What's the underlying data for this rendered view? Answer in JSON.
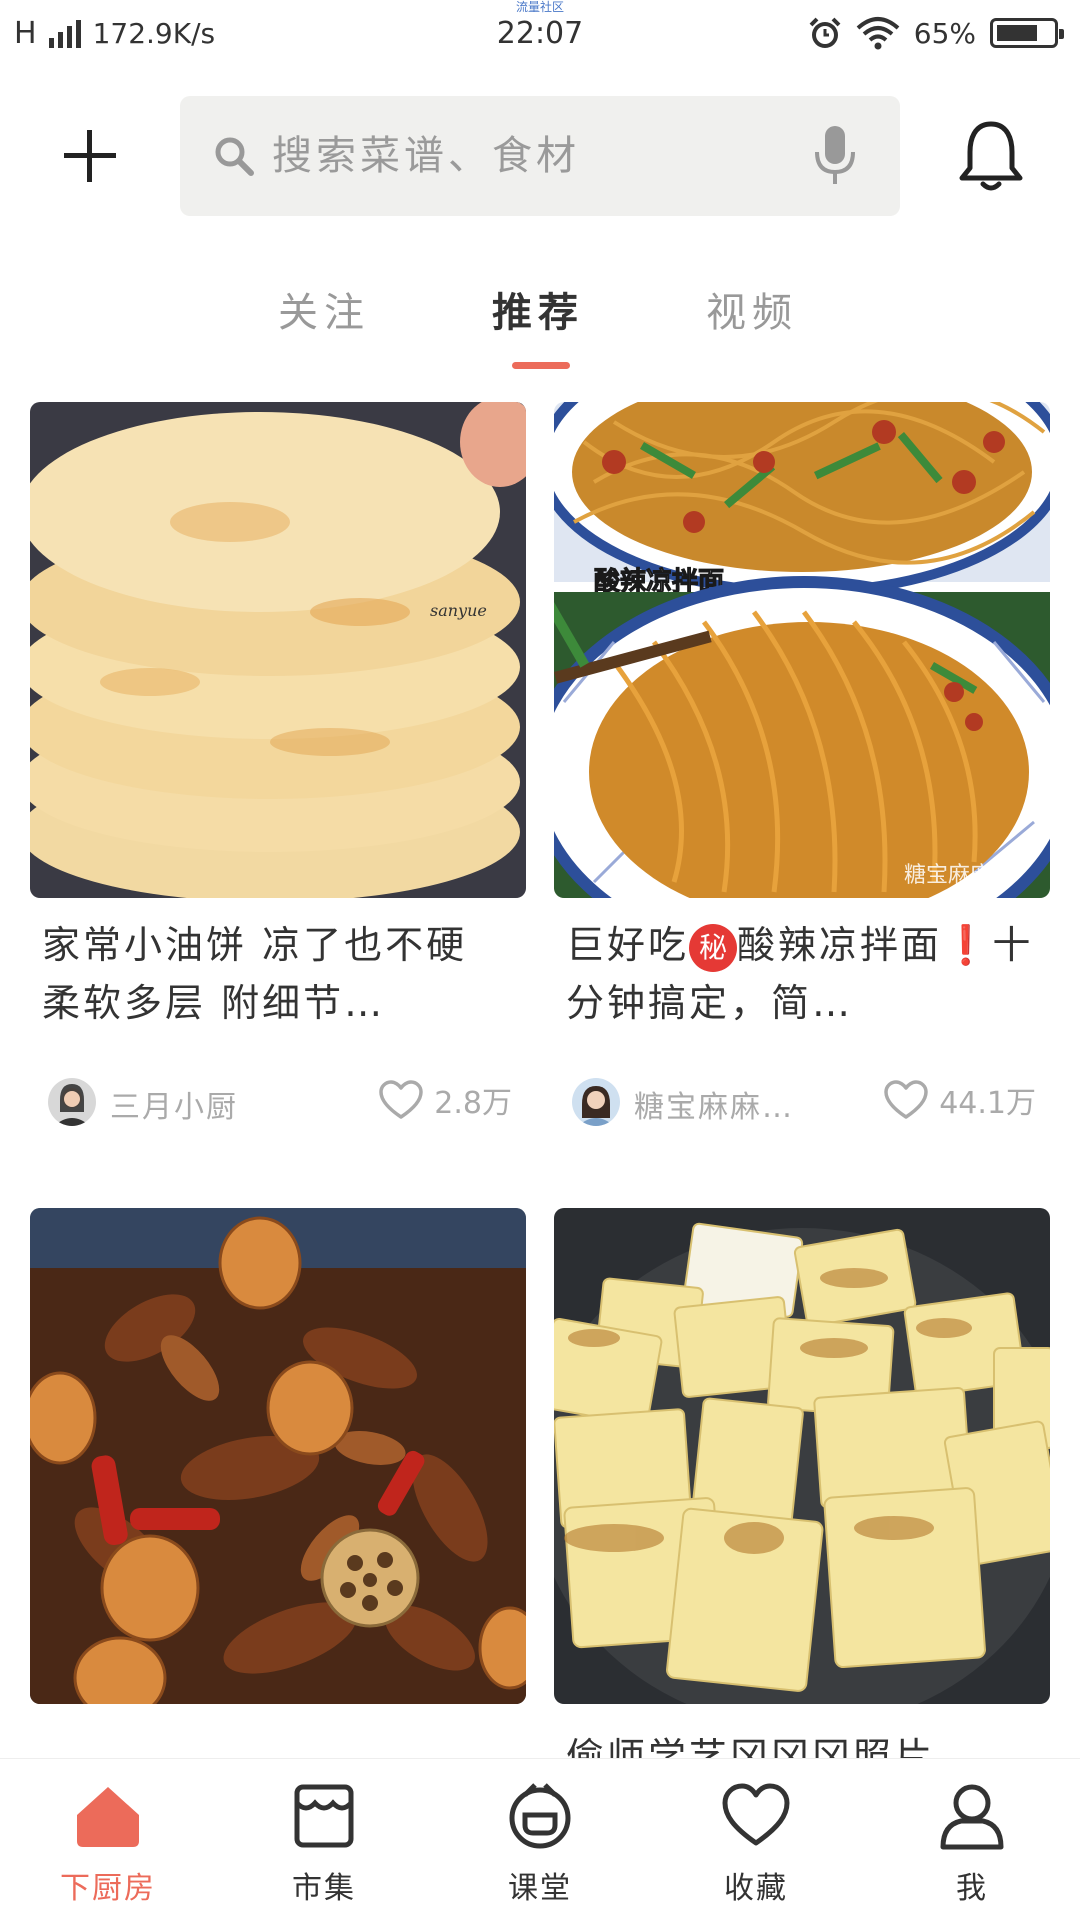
{
  "status_bar": {
    "network": "H",
    "speed": "172.9K/s",
    "watermark": "流量社区",
    "time": "22:07",
    "battery": "65%"
  },
  "search": {
    "placeholder": "搜索菜谱、食材"
  },
  "tabs": [
    {
      "label": "关注",
      "active": false
    },
    {
      "label": "推荐",
      "active": true
    },
    {
      "label": "视频",
      "active": false
    }
  ],
  "feed": [
    {
      "title": "家常小油饼 凉了也不硬 柔软多层 附细节…",
      "author": "三月小厨",
      "likes": "2.8万",
      "watermark": "sanyue"
    },
    {
      "title_pre": "巨好吃",
      "badge": "秘",
      "title_mid": "酸辣凉拌面",
      "exclaim": "❗",
      "title_post": "十分钟搞定，简…",
      "author": "糖宝麻麻…",
      "likes": "44.1万",
      "image_caption": "酸辣凉拌面",
      "watermark": "糖宝麻麻"
    },
    {
      "title": "",
      "author": "",
      "likes": ""
    },
    {
      "title": "偷师学艺冈冈冈照片",
      "author": "",
      "likes": ""
    }
  ],
  "bottom_nav": [
    {
      "label": "下厨房",
      "icon": "home-icon",
      "active": true
    },
    {
      "label": "市集",
      "icon": "market-icon",
      "active": false
    },
    {
      "label": "课堂",
      "icon": "classroom-icon",
      "active": false
    },
    {
      "label": "收藏",
      "icon": "heart-icon",
      "active": false
    },
    {
      "label": "我",
      "icon": "profile-icon",
      "active": false
    }
  ],
  "colors": {
    "accent": "#ec6b5a",
    "search_bg": "#f0f0ee",
    "muted_text": "#aaaaaa"
  }
}
